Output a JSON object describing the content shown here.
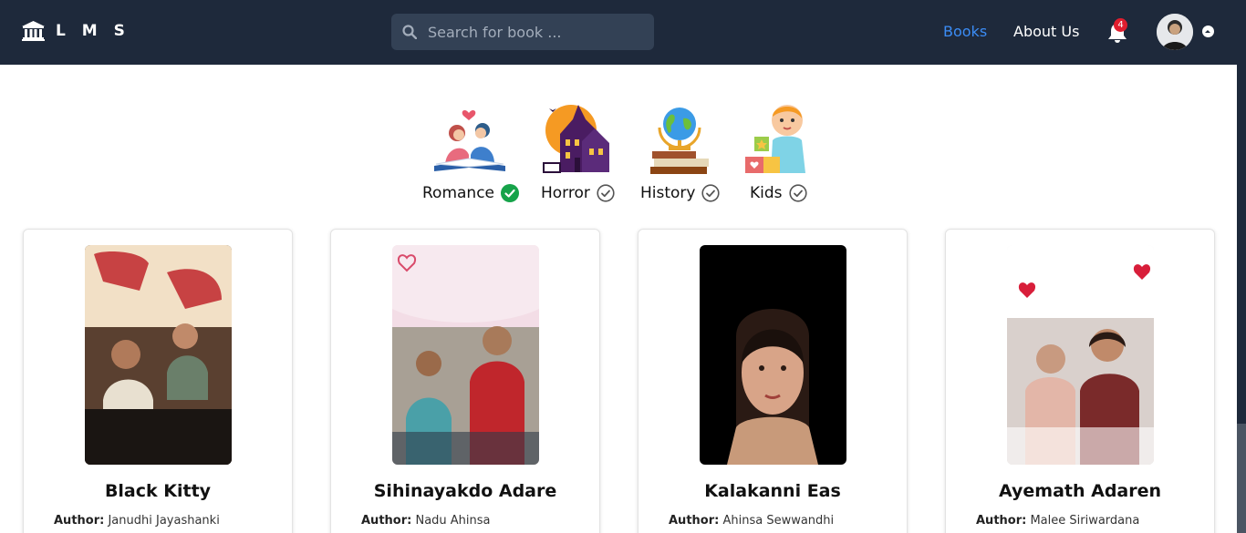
{
  "header": {
    "logo_text": "L M S",
    "search_placeholder": "Search for book ...",
    "nav": {
      "books": "Books",
      "about": "About Us"
    },
    "notification_count": "4"
  },
  "categories": [
    {
      "label": "Romance",
      "selected": true
    },
    {
      "label": "Horror",
      "selected": false
    },
    {
      "label": "History",
      "selected": false
    },
    {
      "label": "Kids",
      "selected": false
    }
  ],
  "books": [
    {
      "title": "Black Kitty",
      "author_label": "Author:",
      "author": "Janudhi Jayashanki"
    },
    {
      "title": "Sihinayakdo Adare",
      "author_label": "Author:",
      "author": "Nadu Ahinsa"
    },
    {
      "title": "Kalakanni Eas",
      "author_label": "Author:",
      "author": "Ahinsa Sewwandhi"
    },
    {
      "title": "Ayemath Adaren",
      "author_label": "Author:",
      "author": "Malee Siriwardana"
    }
  ],
  "colors": {
    "header_bg": "#1e293b",
    "search_bg": "#334155",
    "active_nav": "#3b8cf5",
    "selected_check": "#16a34a",
    "badge": "#e11d2e"
  }
}
